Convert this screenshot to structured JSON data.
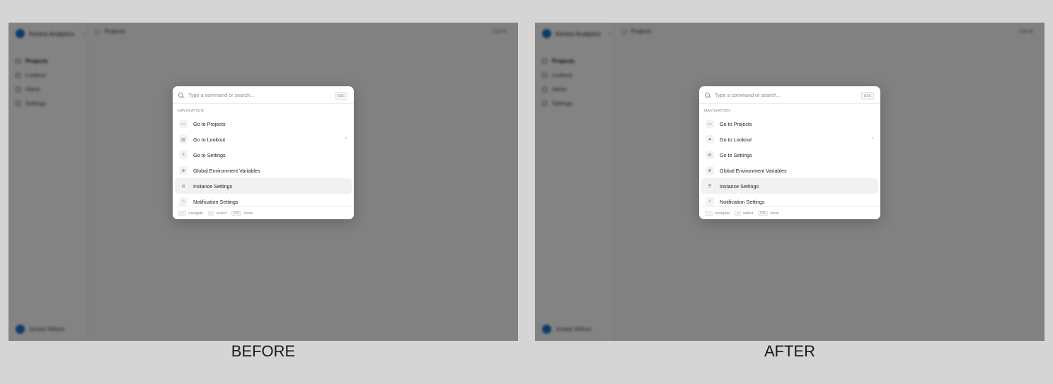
{
  "app": {
    "org_name": "Kestra Analytics",
    "breadcrumb": "Projects",
    "top_right": "Ctrl K",
    "nav_items": [
      "Projects",
      "Lookout",
      "Alerts",
      "Settings"
    ],
    "user_name": "Jordan Wilson"
  },
  "panels": [
    {
      "caption": "BEFORE",
      "search_placeholder": "Type a command or search...",
      "esc_key": "ESC",
      "section_label": "NAVIGATION",
      "items": [
        {
          "label": "Go to Projects",
          "icon": "folder-icon",
          "glyph": "▭"
        },
        {
          "label": "Go to Lookout",
          "icon": "bar-chart-icon",
          "glyph": "▥"
        },
        {
          "label": "Go to Settings",
          "icon": "sliders-icon",
          "glyph": "≡"
        },
        {
          "label": "Global Environment Variables",
          "icon": "globe-icon",
          "glyph": "⊕"
        },
        {
          "label": "Instance Settings",
          "icon": "server-icon",
          "glyph": "⊟"
        },
        {
          "label": "Notification Settings",
          "icon": "bell-icon",
          "glyph": "⌂"
        }
      ],
      "selected_index": 4,
      "arrow_index": 1,
      "footer": [
        {
          "key": "↑↓",
          "label": "navigate"
        },
        {
          "key": "↵",
          "label": "select"
        },
        {
          "key": "ESC",
          "label": "close"
        }
      ]
    },
    {
      "caption": "AFTER",
      "search_placeholder": "Type a command or search...",
      "esc_key": "ESC",
      "section_label": "NAVIGATION",
      "items": [
        {
          "label": "Go to Projects",
          "icon": "folder-icon",
          "glyph": "▭"
        },
        {
          "label": "Go to Lookout",
          "icon": "bar-chart-icon",
          "glyph": "▲"
        },
        {
          "label": "Go to Settings",
          "icon": "gear-icon",
          "glyph": "⚙"
        },
        {
          "label": "Global Environment Variables",
          "icon": "globe-icon",
          "glyph": "⊕"
        },
        {
          "label": "Instance Settings",
          "icon": "server-icon",
          "glyph": "☰"
        },
        {
          "label": "Notification Settings",
          "icon": "bell-icon",
          "glyph": "♫"
        }
      ],
      "selected_index": 4,
      "arrow_index": 1,
      "footer": [
        {
          "key": "↑↓",
          "label": "navigate"
        },
        {
          "key": "↵",
          "label": "select"
        },
        {
          "key": "ESC",
          "label": "close"
        }
      ]
    }
  ]
}
